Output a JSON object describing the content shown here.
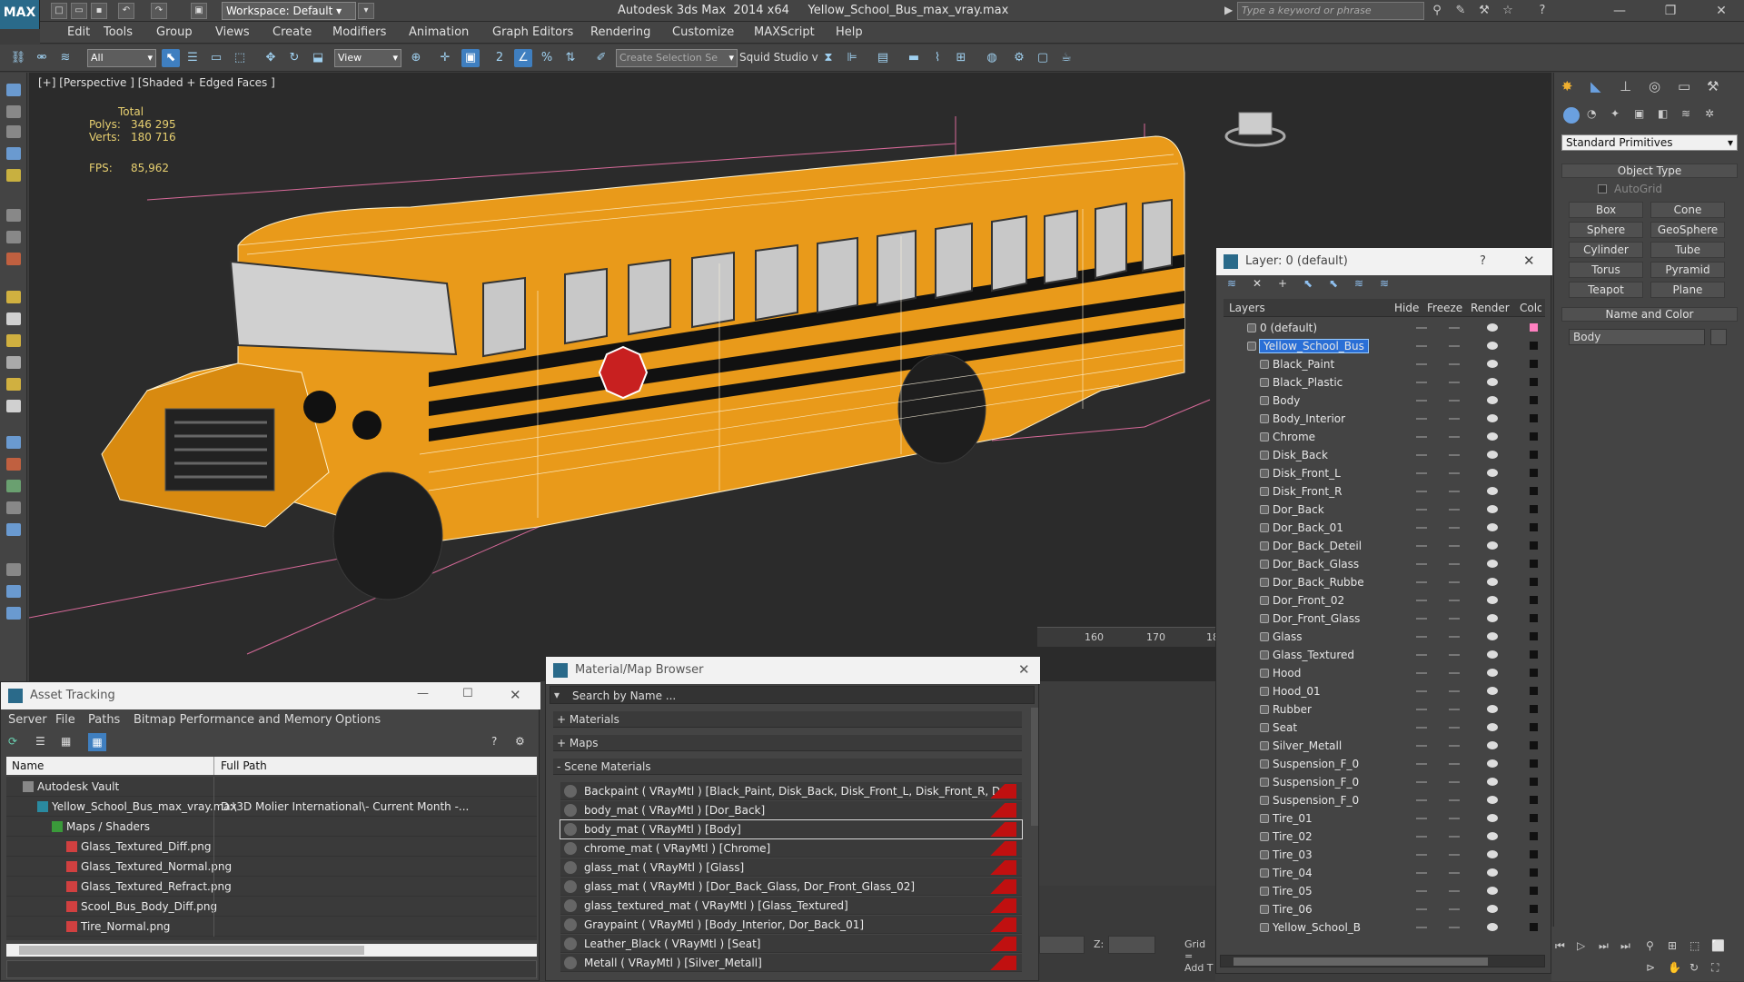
{
  "title_bar": {
    "app_logo": "MAX",
    "workspace": "Workspace: Default",
    "title": "Autodesk 3ds Max  2014 x64     Yellow_School_Bus_max_vray.max",
    "search_placeholder": "Type a keyword or phrase"
  },
  "menu": [
    "Edit",
    "Tools",
    "Group",
    "Views",
    "Create",
    "Modifiers",
    "Animation",
    "Graph Editors",
    "Rendering",
    "Customize",
    "MAXScript",
    "Help"
  ],
  "toolbar": {
    "filter_select": "All",
    "view_select": "View",
    "selection_set": "Create Selection Se",
    "studio_label": "Squid Studio v"
  },
  "viewport": {
    "label": "[+] [Perspective ] [Shaded + Edged Faces ]",
    "stats": {
      "header": "Total",
      "polys_label": "Polys:",
      "polys": "346 295",
      "verts_label": "Verts:",
      "verts": "180 716",
      "fps_label": "FPS:",
      "fps": "85,962"
    },
    "ruler_ticks": [
      "160",
      "170",
      "18"
    ],
    "z_label": "Z:",
    "grid_label": "Grid =",
    "add_t_label": "Add T"
  },
  "command_panel": {
    "category": "Standard Primitives",
    "object_type_header": "Object Type",
    "autogrid_label": "AutoGrid",
    "primitives": [
      "Box",
      "Cone",
      "Sphere",
      "GeoSphere",
      "Cylinder",
      "Tube",
      "Torus",
      "Pyramid",
      "Teapot",
      "Plane"
    ],
    "name_color_header": "Name and Color",
    "name_value": "Body"
  },
  "layer_panel": {
    "title": "Layer: 0 (default)",
    "help": "?",
    "columns": {
      "layers": "Layers",
      "hide": "Hide",
      "freeze": "Freeze",
      "render": "Render",
      "color": "Colo"
    },
    "rows": [
      {
        "name": "0 (default)",
        "level": 0,
        "selected": false,
        "kind": "layer",
        "color": "#ff80c0"
      },
      {
        "name": "Yellow_School_Bus",
        "level": 0,
        "selected": true,
        "kind": "layer",
        "color": "#111111"
      },
      {
        "name": "Black_Paint",
        "level": 1,
        "selected": false,
        "kind": "object",
        "color": "#111111"
      },
      {
        "name": "Black_Plastic",
        "level": 1,
        "selected": false,
        "kind": "object",
        "color": "#111111"
      },
      {
        "name": "Body",
        "level": 1,
        "selected": false,
        "kind": "object",
        "color": "#111111"
      },
      {
        "name": "Body_Interior",
        "level": 1,
        "selected": false,
        "kind": "object",
        "color": "#111111"
      },
      {
        "name": "Chrome",
        "level": 1,
        "selected": false,
        "kind": "object",
        "color": "#111111"
      },
      {
        "name": "Disk_Back",
        "level": 1,
        "selected": false,
        "kind": "object",
        "color": "#111111"
      },
      {
        "name": "Disk_Front_L",
        "level": 1,
        "selected": false,
        "kind": "object",
        "color": "#111111"
      },
      {
        "name": "Disk_Front_R",
        "level": 1,
        "selected": false,
        "kind": "object",
        "color": "#111111"
      },
      {
        "name": "Dor_Back",
        "level": 1,
        "selected": false,
        "kind": "object",
        "color": "#111111"
      },
      {
        "name": "Dor_Back_01",
        "level": 1,
        "selected": false,
        "kind": "object",
        "color": "#111111"
      },
      {
        "name": "Dor_Back_Deteil",
        "level": 1,
        "selected": false,
        "kind": "object",
        "color": "#111111"
      },
      {
        "name": "Dor_Back_Glass",
        "level": 1,
        "selected": false,
        "kind": "object",
        "color": "#111111"
      },
      {
        "name": "Dor_Back_Rubbe",
        "level": 1,
        "selected": false,
        "kind": "object",
        "color": "#111111"
      },
      {
        "name": "Dor_Front_02",
        "level": 1,
        "selected": false,
        "kind": "object",
        "color": "#111111"
      },
      {
        "name": "Dor_Front_Glass",
        "level": 1,
        "selected": false,
        "kind": "object",
        "color": "#111111"
      },
      {
        "name": "Glass",
        "level": 1,
        "selected": false,
        "kind": "object",
        "color": "#111111"
      },
      {
        "name": "Glass_Textured",
        "level": 1,
        "selected": false,
        "kind": "object",
        "color": "#111111"
      },
      {
        "name": "Hood",
        "level": 1,
        "selected": false,
        "kind": "object",
        "color": "#111111"
      },
      {
        "name": "Hood_01",
        "level": 1,
        "selected": false,
        "kind": "object",
        "color": "#111111"
      },
      {
        "name": "Rubber",
        "level": 1,
        "selected": false,
        "kind": "object",
        "color": "#111111"
      },
      {
        "name": "Seat",
        "level": 1,
        "selected": false,
        "kind": "object",
        "color": "#111111"
      },
      {
        "name": "Silver_Metall",
        "level": 1,
        "selected": false,
        "kind": "object",
        "color": "#111111"
      },
      {
        "name": "Suspension_F_0",
        "level": 1,
        "selected": false,
        "kind": "object",
        "color": "#111111"
      },
      {
        "name": "Suspension_F_0",
        "level": 1,
        "selected": false,
        "kind": "object",
        "color": "#111111"
      },
      {
        "name": "Suspension_F_0",
        "level": 1,
        "selected": false,
        "kind": "object",
        "color": "#111111"
      },
      {
        "name": "Tire_01",
        "level": 1,
        "selected": false,
        "kind": "object",
        "color": "#111111"
      },
      {
        "name": "Tire_02",
        "level": 1,
        "selected": false,
        "kind": "object",
        "color": "#111111"
      },
      {
        "name": "Tire_03",
        "level": 1,
        "selected": false,
        "kind": "object",
        "color": "#111111"
      },
      {
        "name": "Tire_04",
        "level": 1,
        "selected": false,
        "kind": "object",
        "color": "#111111"
      },
      {
        "name": "Tire_05",
        "level": 1,
        "selected": false,
        "kind": "object",
        "color": "#111111"
      },
      {
        "name": "Tire_06",
        "level": 1,
        "selected": false,
        "kind": "object",
        "color": "#111111"
      },
      {
        "name": "Yellow_School_B",
        "level": 1,
        "selected": false,
        "kind": "object",
        "color": "#111111"
      }
    ]
  },
  "asset_tracking": {
    "title": "Asset Tracking",
    "menu": [
      "Server",
      "File",
      "Paths",
      "Bitmap Performance and Memory",
      "Options"
    ],
    "columns": {
      "name": "Name",
      "path": "Full Path"
    },
    "rows": [
      {
        "name": "Autodesk Vault",
        "path": "",
        "level": 0,
        "kind": "vault"
      },
      {
        "name": "Yellow_School_Bus_max_vray.max",
        "path": "D:\\3D Molier International\\- Current Month -...",
        "level": 1,
        "kind": "max"
      },
      {
        "name": "Maps / Shaders",
        "path": "",
        "level": 2,
        "kind": "folder"
      },
      {
        "name": "Glass_Textured_Diff.png",
        "path": "",
        "level": 3,
        "kind": "png"
      },
      {
        "name": "Glass_Textured_Normal.png",
        "path": "",
        "level": 3,
        "kind": "png"
      },
      {
        "name": "Glass_Textured_Refract.png",
        "path": "",
        "level": 3,
        "kind": "png"
      },
      {
        "name": "Scool_Bus_Body_Diff.png",
        "path": "",
        "level": 3,
        "kind": "png"
      },
      {
        "name": "Tire_Normal.png",
        "path": "",
        "level": 3,
        "kind": "png"
      }
    ]
  },
  "material_browser": {
    "title": "Material/Map Browser",
    "search_placeholder": "Search by Name ...",
    "groups": [
      "+ Materials",
      "+ Maps",
      "- Scene Materials"
    ],
    "materials": [
      "Backpaint  ( VRayMtl ) [Black_Paint, Disk_Back, Disk_Front_L, Disk_Front_R, Do...",
      "body_mat  ( VRayMtl ) [Dor_Back]",
      "body_mat  ( VRayMtl ) [Body]",
      "chrome_mat  ( VRayMtl ) [Chrome]",
      "glass_mat  ( VRayMtl ) [Glass]",
      "glass_mat  ( VRayMtl ) [Dor_Back_Glass, Dor_Front_Glass_02]",
      "glass_textured_mat  ( VRayMtl ) [Glass_Textured]",
      "Graypaint  ( VRayMtl ) [Body_Interior, Dor_Back_01]",
      "Leather_Black  ( VRayMtl ) [Seat]",
      "Metall  ( VRayMtl ) [Silver_Metall]"
    ],
    "selected_index": 2
  },
  "colors": {
    "selection_blue": "#2a6fd6",
    "bus_orange": "#e99a1a",
    "material_red": "#c01010"
  }
}
